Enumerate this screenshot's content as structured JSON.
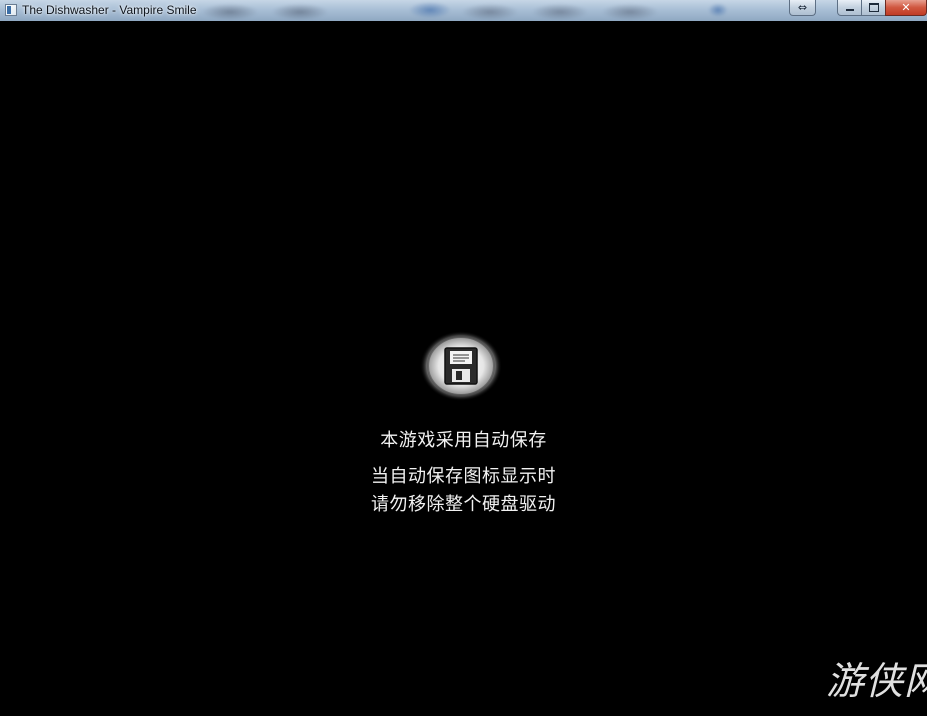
{
  "window": {
    "title": "The Dishwasher - Vampire Smile",
    "controls": {
      "resize_glyph": "⇔",
      "close_glyph": "✕"
    }
  },
  "game": {
    "icon": "floppy-disk-save-icon",
    "autosave_notice": {
      "line1": "本游戏采用自动保存",
      "line2": "当自动保存图标显示时",
      "line3": "请勿移除整个硬盘驱动"
    }
  },
  "watermark": {
    "text": "游侠网"
  },
  "colors": {
    "background": "#000000",
    "text": "#f2f2f2",
    "titlebar": "#a9bfd6",
    "close_button": "#c03b25"
  }
}
